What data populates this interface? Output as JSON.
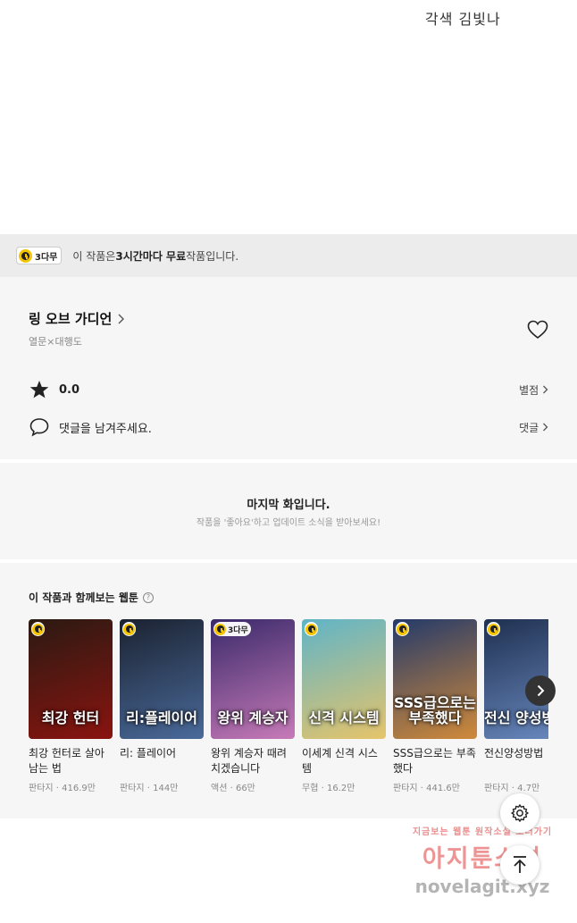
{
  "top": {
    "credit": "각색 김빛나"
  },
  "notice": {
    "badge": "3다무",
    "pre": "이 작품은 ",
    "bold": "3시간마다 무료",
    "post": " 작품입니다."
  },
  "work": {
    "title": "링 오브 가디언",
    "author": "열문×대행도",
    "rating": "0.0",
    "rating_link": "별점",
    "comment_prompt": "댓글을 남겨주세요.",
    "comment_link": "댓글"
  },
  "last": {
    "title": "마지막 화입니다.",
    "subtitle": "작품을 '좋아요'하고 업데이트 소식을 받아보세요!"
  },
  "recommend": {
    "heading": "이 작품과 함께보는 웹툰",
    "items": [
      {
        "title": "최강 헌터로 살아남는 법",
        "genre": "판타지",
        "views": "416.9만",
        "cover_text": "최강 헌터",
        "badge": "",
        "color_a": "#2a1a12",
        "color_b": "#8a1410"
      },
      {
        "title": "리: 플레이어",
        "genre": "판타지",
        "views": "144만",
        "cover_text": "리:플레이어",
        "badge": "",
        "color_a": "#1b2230",
        "color_b": "#4a6a9a"
      },
      {
        "title": "왕위 계승자 때려치겠습니다",
        "genre": "액션",
        "views": "66만",
        "cover_text": "왕위 계승자",
        "badge": "3다무",
        "color_a": "#3a2a6a",
        "color_b": "#c77ab8"
      },
      {
        "title": "이세계 신격 시스템",
        "genre": "무협",
        "views": "16.2만",
        "cover_text": "신격 시스템",
        "badge": "",
        "color_a": "#5fb4c8",
        "color_b": "#e6c46a"
      },
      {
        "title": "SSS급으로는 부족했다",
        "genre": "판타지",
        "views": "441.6만",
        "cover_text": "SSS급으로는 부족했다",
        "badge": "",
        "color_a": "#243a6a",
        "color_b": "#d08a3a"
      },
      {
        "title": "전신양성방법",
        "genre": "판타지",
        "views": "4.7만",
        "cover_text": "전신 양성방법",
        "badge": "",
        "color_a": "#1f3050",
        "color_b": "#6a8ac0"
      }
    ]
  },
  "icons": {
    "settings": "gear-icon",
    "scroll_top": "arrow-up-icon",
    "next": "chevron-right-icon"
  },
  "watermark": {
    "line1": "지금보는 웹툰 원작소설 보러가기",
    "line2": "아지툰소설",
    "line3": "novelagit.xyz"
  }
}
